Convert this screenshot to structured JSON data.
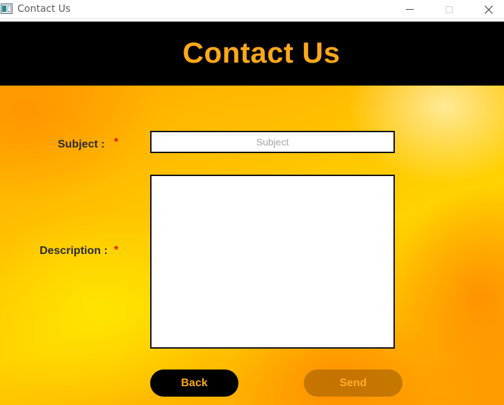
{
  "window": {
    "title": "Contact Us",
    "icon": "app-window-icon",
    "controls": [
      "minimize-icon",
      "maximize-icon",
      "close-icon"
    ]
  },
  "header": {
    "title": "Contact Us"
  },
  "form": {
    "subject": {
      "label": "Subject :",
      "required_marker": "*",
      "placeholder": "Subject",
      "value": ""
    },
    "description": {
      "label": "Description :",
      "required_marker": "*",
      "value": ""
    }
  },
  "buttons": {
    "back_label": "Back",
    "send_label": "Send",
    "send_state": "disabled"
  },
  "colors": {
    "header_bg": "#000000",
    "accent": "#ffa81a",
    "required": "#e01010"
  }
}
